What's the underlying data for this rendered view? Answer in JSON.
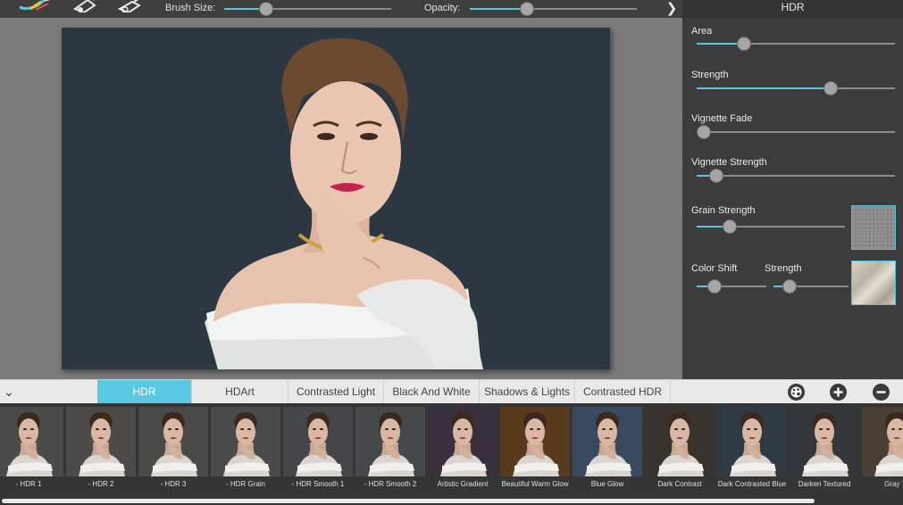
{
  "toolbar": {
    "tools": [
      "brush-tool-icon",
      "eraser-tool-icon",
      "hand-tool-icon"
    ],
    "brush_size_label": "Brush Size:",
    "brush_size_value": 0.23,
    "opacity_label": "Opacity:",
    "opacity_value": 0.33,
    "next_icon": "chevron-right-icon",
    "accent_color": "#5ac8e0"
  },
  "panel": {
    "title": "HDR",
    "controls": [
      {
        "label": "Area",
        "value": 0.22
      },
      {
        "label": "Strength",
        "value": 0.69
      },
      {
        "label": "Vignette Fade",
        "value": 0.0
      },
      {
        "label": "Vignette Strength",
        "value": 0.07
      },
      {
        "label": "Grain Strength",
        "value": 0.19
      }
    ],
    "color_shift_label": "Color Shift",
    "color_shift_value": 0.2,
    "color_strength_label": "Strength",
    "color_strength_value": 0.15
  },
  "tabs": [
    {
      "label": "HDR",
      "active": true
    },
    {
      "label": "HDArt",
      "active": false
    },
    {
      "label": "Contrasted Light",
      "active": false
    },
    {
      "label": "Black And White",
      "active": false
    },
    {
      "label": "Shadows & Lights",
      "active": false
    },
    {
      "label": "Contrasted HDR",
      "active": false
    }
  ],
  "tab_actions": {
    "collapse_icon": "chevron-down-icon",
    "palette_icon": "palette-icon",
    "add_icon": "plus-icon",
    "remove_icon": "minus-icon"
  },
  "presets": [
    {
      "label": "- HDR 1",
      "tone": "#4a4a48"
    },
    {
      "label": "- HDR 2",
      "tone": "#4c4b48"
    },
    {
      "label": "- HDR 3",
      "tone": "#4a4a49"
    },
    {
      "label": "- HDR Grain",
      "tone": "#4b4b4b"
    },
    {
      "label": "- HDR Smooth 1",
      "tone": "#45464a"
    },
    {
      "label": "- HDR Smooth 2",
      "tone": "#474849"
    },
    {
      "label": "Artistic Gradient",
      "tone": "#3a2f3f"
    },
    {
      "label": "Beautiful Warm Glow",
      "tone": "#5a3a1c"
    },
    {
      "label": "Blue Glow",
      "tone": "#3a4a5e"
    },
    {
      "label": "Dark Contrast",
      "tone": "#3a342e"
    },
    {
      "label": "Dark Contrasted Blue",
      "tone": "#2f3a44"
    },
    {
      "label": "Darken Textured",
      "tone": "#34373a"
    },
    {
      "label": "Gray To",
      "tone": "#4a3f33"
    }
  ]
}
